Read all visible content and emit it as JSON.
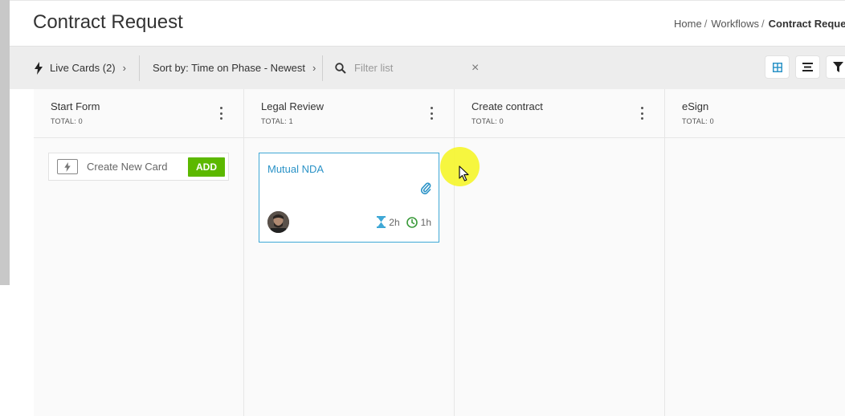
{
  "header": {
    "title": "Contract Request",
    "breadcrumb": [
      {
        "label": "Home"
      },
      {
        "label": "Workflows"
      },
      {
        "label": "Contract Request"
      }
    ]
  },
  "toolbar": {
    "live_cards_label": "Live Cards (2)",
    "sort_label": "Sort by: Time on Phase - Newest",
    "filter_placeholder": "Filter list",
    "clear_glyph": "×"
  },
  "colors": {
    "accent": "#2b93c7",
    "add_green": "#5cb800",
    "card_border": "#3fa8d6",
    "cursor_highlight": "#f5f52a"
  },
  "columns": [
    {
      "title": "Start Form",
      "total": "TOTAL: 0"
    },
    {
      "title": "Legal Review",
      "total": "TOTAL: 1"
    },
    {
      "title": "Create contract",
      "total": "TOTAL: 0"
    },
    {
      "title": "eSign",
      "total": "TOTAL: 0"
    }
  ],
  "new_card": {
    "label": "Create New Card",
    "add_label": "ADD"
  },
  "card": {
    "title": "Mutual NDA",
    "time_in_phase": "2h",
    "time_total": "1h",
    "icons": [
      "paperclip-icon",
      "hourglass-icon",
      "clock-icon"
    ]
  }
}
